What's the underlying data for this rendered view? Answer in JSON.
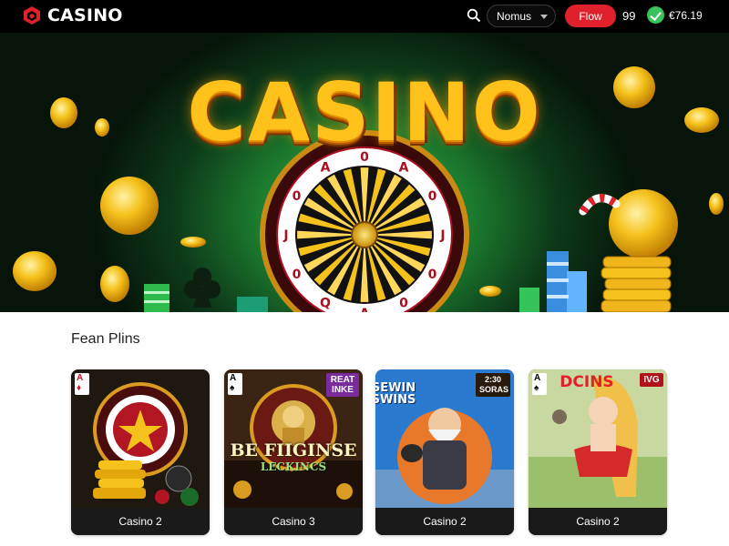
{
  "header": {
    "brand": "CASINO",
    "bonus_label": "Nomus",
    "flow_label": "Flow",
    "count": "99",
    "balance": "€76.19"
  },
  "hero": {
    "title": "CASINO",
    "wheel_letters": [
      "0",
      "A",
      "0",
      "J",
      "0",
      "0",
      "A",
      "Q",
      "0",
      "J",
      "0",
      "A"
    ]
  },
  "games_section": {
    "title": "Fean Plins",
    "cards": [
      {
        "label": "Casino 2",
        "corner_card": "A",
        "suit": "♦",
        "corner_color": "#d0162a"
      },
      {
        "label": "Casino 3",
        "corner_card": "A",
        "suit": "♠",
        "corner_color": "#111111",
        "tag": "REAT INKE",
        "tag_color": "#7a2c9c",
        "art_title": "BE FIIGINSE",
        "art_subtitle": "LECKINCS"
      },
      {
        "label": "Casino 2",
        "art_title": "SEWIN SWINS",
        "tag": "2:30 SORAS",
        "tag_color": "#2a1a0c"
      },
      {
        "label": "Casino 2",
        "corner_card": "A",
        "suit": "♠",
        "corner_color": "#111111",
        "art_title": "DCINS",
        "tag": "IVG",
        "tag_color": "#b1121a"
      }
    ]
  },
  "colors": {
    "accent_red": "#e0202a",
    "gold": "#ffc21a",
    "hero_green": "#1c7a2e",
    "topbar": "#000000"
  },
  "icons": {
    "logo": "cube-logo-icon",
    "search": "search-icon",
    "dropdown": "chevron-down-icon",
    "wallet": "check-circle-icon"
  }
}
